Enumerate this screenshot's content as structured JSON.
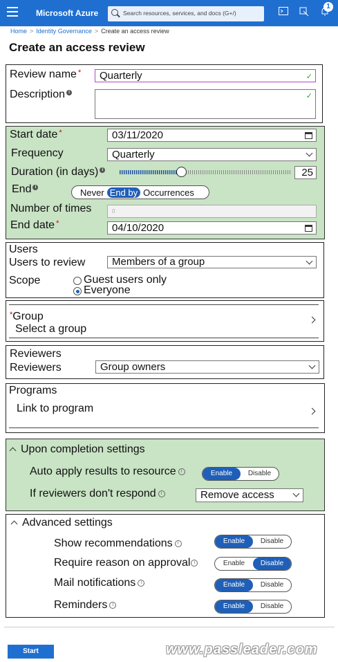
{
  "topbar": {
    "brand": "Microsoft Azure",
    "search_placeholder": "Search resources, services, and docs (G+/)",
    "notification_count": "1"
  },
  "breadcrumb": [
    "Home",
    "Identity Governance",
    "Create an access review"
  ],
  "page_title": "Create an access review",
  "review": {
    "name_label": "Review name",
    "name_value": "Quarterly",
    "description_label": "Description"
  },
  "schedule": {
    "start_date_label": "Start date",
    "start_date_value": "03/11/2020",
    "frequency_label": "Frequency",
    "frequency_value": "Quarterly",
    "duration_label": "Duration (in days)",
    "duration_value": "25",
    "duration_fraction": 0.36,
    "end_label": "End",
    "end_options": [
      "Never",
      "End by",
      "Occurrences"
    ],
    "end_selected": "End by",
    "number_label": "Number of times",
    "number_value": "0",
    "end_date_label": "End date",
    "end_date_value": "04/10/2020"
  },
  "users": {
    "heading": "Users",
    "review_label": "Users to review",
    "review_value": "Members of a group",
    "scope_label": "Scope",
    "scope_options": [
      "Guest users only",
      "Everyone"
    ],
    "scope_selected": "Everyone"
  },
  "group": {
    "label": "Group",
    "placeholder": "Select a group"
  },
  "reviewers": {
    "heading": "Reviewers",
    "label": "Reviewers",
    "value": "Group owners"
  },
  "programs": {
    "heading": "Programs",
    "link_label": "Link to program"
  },
  "completion": {
    "heading": "Upon completion settings",
    "auto_apply_label": "Auto apply results to resource",
    "auto_apply_options": [
      "Enable",
      "Disable"
    ],
    "auto_apply_selected": "Enable",
    "no_response_label": "If reviewers don't respond",
    "no_response_value": "Remove access"
  },
  "advanced": {
    "heading": "Advanced settings",
    "rows": [
      {
        "label": "Show recommendations",
        "selected": "Enable"
      },
      {
        "label": "Require reason on approval",
        "selected": "Disable"
      },
      {
        "label": "Mail notifications",
        "selected": "Enable"
      },
      {
        "label": "Reminders",
        "selected": "Enable"
      }
    ],
    "toggle_labels": [
      "Enable",
      "Disable"
    ]
  },
  "footer": {
    "start_label": "Start",
    "watermark": "www.passleader.com"
  },
  "colors": {
    "azure_blue": "#1f6fd1",
    "highlight_green": "#c9e3c5",
    "toggle_on": "#1f5fb8"
  }
}
